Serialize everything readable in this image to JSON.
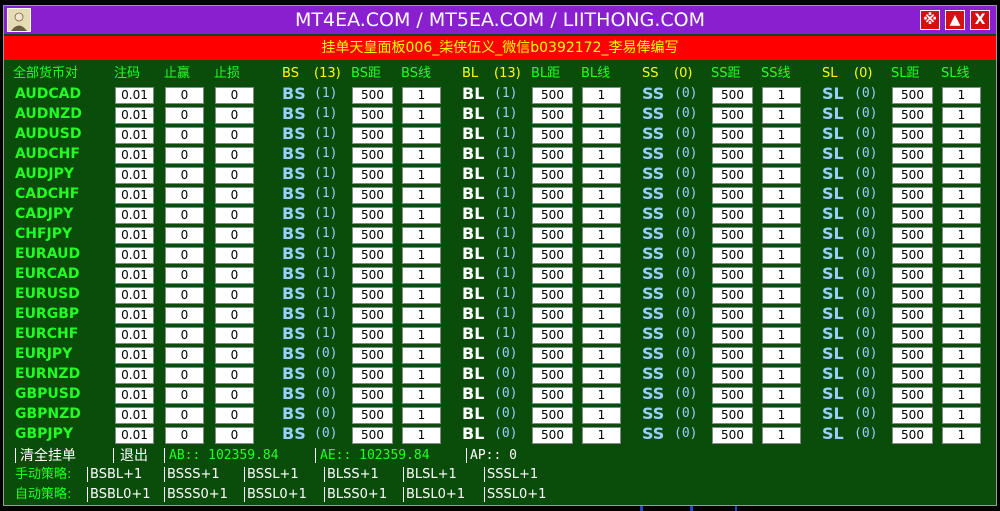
{
  "window": {
    "title": "MT4EA.COM / MT5EA.COM / LIITHONG.COM",
    "subtitle": "挂单天皇面板006_柒侠伍义_微信b0392172_李易俸编写",
    "buttons": [
      "※",
      "▲",
      "X"
    ]
  },
  "headers": {
    "all_pairs": "全部货币对",
    "lot": "注码",
    "tp": "止赢",
    "sl": "止损",
    "bs": "BS",
    "bs_count": "(13)",
    "bs_dist": "BS距",
    "bs_line": "BS线",
    "bl": "BL",
    "bl_count": "(13)",
    "bl_dist": "BL距",
    "bl_line": "BL线",
    "ss": "SS",
    "ss_count": "(0)",
    "ss_dist": "SS距",
    "ss_line": "SS线",
    "sl2": "SL",
    "sl2_count": "(0)",
    "sl2_dist": "SL距",
    "sl2_line": "SL线"
  },
  "row_labels": {
    "bs": "BS",
    "bl": "BL",
    "ss": "SS",
    "sl": "SL"
  },
  "rows": [
    {
      "symbol": "AUDCAD",
      "lot": "0.01",
      "tp": "0",
      "sl": "0",
      "bs_n": "(1)",
      "bs_dist": "500",
      "bs_line": "1",
      "bl_n": "(1)",
      "bl_dist": "500",
      "bl_line": "1",
      "ss_n": "(0)",
      "ss_dist": "500",
      "ss_line": "1",
      "sl_n": "(0)",
      "sl_dist": "500",
      "sl_line": "1"
    },
    {
      "symbol": "AUDNZD",
      "lot": "0.01",
      "tp": "0",
      "sl": "0",
      "bs_n": "(1)",
      "bs_dist": "500",
      "bs_line": "1",
      "bl_n": "(1)",
      "bl_dist": "500",
      "bl_line": "1",
      "ss_n": "(0)",
      "ss_dist": "500",
      "ss_line": "1",
      "sl_n": "(0)",
      "sl_dist": "500",
      "sl_line": "1"
    },
    {
      "symbol": "AUDUSD",
      "lot": "0.01",
      "tp": "0",
      "sl": "0",
      "bs_n": "(1)",
      "bs_dist": "500",
      "bs_line": "1",
      "bl_n": "(1)",
      "bl_dist": "500",
      "bl_line": "1",
      "ss_n": "(0)",
      "ss_dist": "500",
      "ss_line": "1",
      "sl_n": "(0)",
      "sl_dist": "500",
      "sl_line": "1"
    },
    {
      "symbol": "AUDCHF",
      "lot": "0.01",
      "tp": "0",
      "sl": "0",
      "bs_n": "(1)",
      "bs_dist": "500",
      "bs_line": "1",
      "bl_n": "(1)",
      "bl_dist": "500",
      "bl_line": "1",
      "ss_n": "(0)",
      "ss_dist": "500",
      "ss_line": "1",
      "sl_n": "(0)",
      "sl_dist": "500",
      "sl_line": "1"
    },
    {
      "symbol": "AUDJPY",
      "lot": "0.01",
      "tp": "0",
      "sl": "0",
      "bs_n": "(1)",
      "bs_dist": "500",
      "bs_line": "1",
      "bl_n": "(1)",
      "bl_dist": "500",
      "bl_line": "1",
      "ss_n": "(0)",
      "ss_dist": "500",
      "ss_line": "1",
      "sl_n": "(0)",
      "sl_dist": "500",
      "sl_line": "1"
    },
    {
      "symbol": "CADCHF",
      "lot": "0.01",
      "tp": "0",
      "sl": "0",
      "bs_n": "(1)",
      "bs_dist": "500",
      "bs_line": "1",
      "bl_n": "(1)",
      "bl_dist": "500",
      "bl_line": "1",
      "ss_n": "(0)",
      "ss_dist": "500",
      "ss_line": "1",
      "sl_n": "(0)",
      "sl_dist": "500",
      "sl_line": "1"
    },
    {
      "symbol": "CADJPY",
      "lot": "0.01",
      "tp": "0",
      "sl": "0",
      "bs_n": "(1)",
      "bs_dist": "500",
      "bs_line": "1",
      "bl_n": "(1)",
      "bl_dist": "500",
      "bl_line": "1",
      "ss_n": "(0)",
      "ss_dist": "500",
      "ss_line": "1",
      "sl_n": "(0)",
      "sl_dist": "500",
      "sl_line": "1"
    },
    {
      "symbol": "CHFJPY",
      "lot": "0.01",
      "tp": "0",
      "sl": "0",
      "bs_n": "(1)",
      "bs_dist": "500",
      "bs_line": "1",
      "bl_n": "(1)",
      "bl_dist": "500",
      "bl_line": "1",
      "ss_n": "(0)",
      "ss_dist": "500",
      "ss_line": "1",
      "sl_n": "(0)",
      "sl_dist": "500",
      "sl_line": "1"
    },
    {
      "symbol": "EURAUD",
      "lot": "0.01",
      "tp": "0",
      "sl": "0",
      "bs_n": "(1)",
      "bs_dist": "500",
      "bs_line": "1",
      "bl_n": "(1)",
      "bl_dist": "500",
      "bl_line": "1",
      "ss_n": "(0)",
      "ss_dist": "500",
      "ss_line": "1",
      "sl_n": "(0)",
      "sl_dist": "500",
      "sl_line": "1"
    },
    {
      "symbol": "EURCAD",
      "lot": "0.01",
      "tp": "0",
      "sl": "0",
      "bs_n": "(1)",
      "bs_dist": "500",
      "bs_line": "1",
      "bl_n": "(1)",
      "bl_dist": "500",
      "bl_line": "1",
      "ss_n": "(0)",
      "ss_dist": "500",
      "ss_line": "1",
      "sl_n": "(0)",
      "sl_dist": "500",
      "sl_line": "1"
    },
    {
      "symbol": "EURUSD",
      "lot": "0.01",
      "tp": "0",
      "sl": "0",
      "bs_n": "(1)",
      "bs_dist": "500",
      "bs_line": "1",
      "bl_n": "(1)",
      "bl_dist": "500",
      "bl_line": "1",
      "ss_n": "(0)",
      "ss_dist": "500",
      "ss_line": "1",
      "sl_n": "(0)",
      "sl_dist": "500",
      "sl_line": "1"
    },
    {
      "symbol": "EURGBP",
      "lot": "0.01",
      "tp": "0",
      "sl": "0",
      "bs_n": "(1)",
      "bs_dist": "500",
      "bs_line": "1",
      "bl_n": "(1)",
      "bl_dist": "500",
      "bl_line": "1",
      "ss_n": "(0)",
      "ss_dist": "500",
      "ss_line": "1",
      "sl_n": "(0)",
      "sl_dist": "500",
      "sl_line": "1"
    },
    {
      "symbol": "EURCHF",
      "lot": "0.01",
      "tp": "0",
      "sl": "0",
      "bs_n": "(1)",
      "bs_dist": "500",
      "bs_line": "1",
      "bl_n": "(1)",
      "bl_dist": "500",
      "bl_line": "1",
      "ss_n": "(0)",
      "ss_dist": "500",
      "ss_line": "1",
      "sl_n": "(0)",
      "sl_dist": "500",
      "sl_line": "1"
    },
    {
      "symbol": "EURJPY",
      "lot": "0.01",
      "tp": "0",
      "sl": "0",
      "bs_n": "(0)",
      "bs_dist": "500",
      "bs_line": "1",
      "bl_n": "(0)",
      "bl_dist": "500",
      "bl_line": "1",
      "ss_n": "(0)",
      "ss_dist": "500",
      "ss_line": "1",
      "sl_n": "(0)",
      "sl_dist": "500",
      "sl_line": "1"
    },
    {
      "symbol": "EURNZD",
      "lot": "0.01",
      "tp": "0",
      "sl": "0",
      "bs_n": "(0)",
      "bs_dist": "500",
      "bs_line": "1",
      "bl_n": "(0)",
      "bl_dist": "500",
      "bl_line": "1",
      "ss_n": "(0)",
      "ss_dist": "500",
      "ss_line": "1",
      "sl_n": "(0)",
      "sl_dist": "500",
      "sl_line": "1"
    },
    {
      "symbol": "GBPUSD",
      "lot": "0.01",
      "tp": "0",
      "sl": "0",
      "bs_n": "(0)",
      "bs_dist": "500",
      "bs_line": "1",
      "bl_n": "(0)",
      "bl_dist": "500",
      "bl_line": "1",
      "ss_n": "(0)",
      "ss_dist": "500",
      "ss_line": "1",
      "sl_n": "(0)",
      "sl_dist": "500",
      "sl_line": "1"
    },
    {
      "symbol": "GBPNZD",
      "lot": "0.01",
      "tp": "0",
      "sl": "0",
      "bs_n": "(0)",
      "bs_dist": "500",
      "bs_line": "1",
      "bl_n": "(0)",
      "bl_dist": "500",
      "bl_line": "1",
      "ss_n": "(0)",
      "ss_dist": "500",
      "ss_line": "1",
      "sl_n": "(0)",
      "sl_dist": "500",
      "sl_line": "1"
    },
    {
      "symbol": "GBPJPY",
      "lot": "0.01",
      "tp": "0",
      "sl": "0",
      "bs_n": "(0)",
      "bs_dist": "500",
      "bs_line": "1",
      "bl_n": "(0)",
      "bl_dist": "500",
      "bl_line": "1",
      "ss_n": "(0)",
      "ss_dist": "500",
      "ss_line": "1",
      "sl_n": "(0)",
      "sl_dist": "500",
      "sl_line": "1"
    }
  ],
  "footer": {
    "clear_all": "清全挂单",
    "exit": "退出",
    "ab": "AB::  102359.84",
    "ae": "AE::  102359.84",
    "ap": "AP:: 0",
    "manual_label": "手动策略:",
    "manual": [
      "BSBL+1",
      "BSSS+1",
      "BSSL+1",
      "BLSS+1",
      "BLSL+1",
      "SSSL+1"
    ],
    "auto_label": "自动策略:",
    "auto": [
      "BSBL0+1",
      "BSSS0+1",
      "BSSL0+1",
      "BLSS0+1",
      "BLSL0+1",
      "SSSL0+1"
    ]
  },
  "colors": {
    "panel_bg": "#0a4d0a",
    "title_bg": "#8a1fd0",
    "subtitle_bg": "#ff0000",
    "subtitle_text": "#ffff00",
    "symbol_green": "#22ff22",
    "bs_color": "#9ad0ff",
    "bl_color": "#ffffff",
    "header_yellow": "#ffff00"
  },
  "icons": {
    "avatar": "avatar-icon"
  }
}
